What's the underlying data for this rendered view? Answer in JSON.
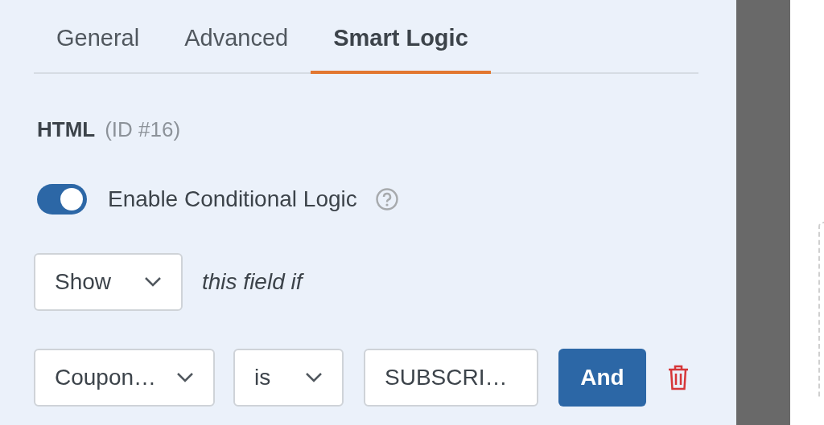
{
  "tabs": [
    {
      "label": "General",
      "selected": false
    },
    {
      "label": "Advanced",
      "selected": false
    },
    {
      "label": "Smart Logic",
      "selected": true
    }
  ],
  "field": {
    "name": "HTML",
    "id": "(ID #16)"
  },
  "conditional_logic": {
    "label": "Enable Conditional Logic",
    "on": true
  },
  "action": {
    "value": "Show",
    "text": "this field if"
  },
  "rule": {
    "field": "Coupon…",
    "operator": "is",
    "value": "SUBSCRI…",
    "and_button": "And"
  }
}
